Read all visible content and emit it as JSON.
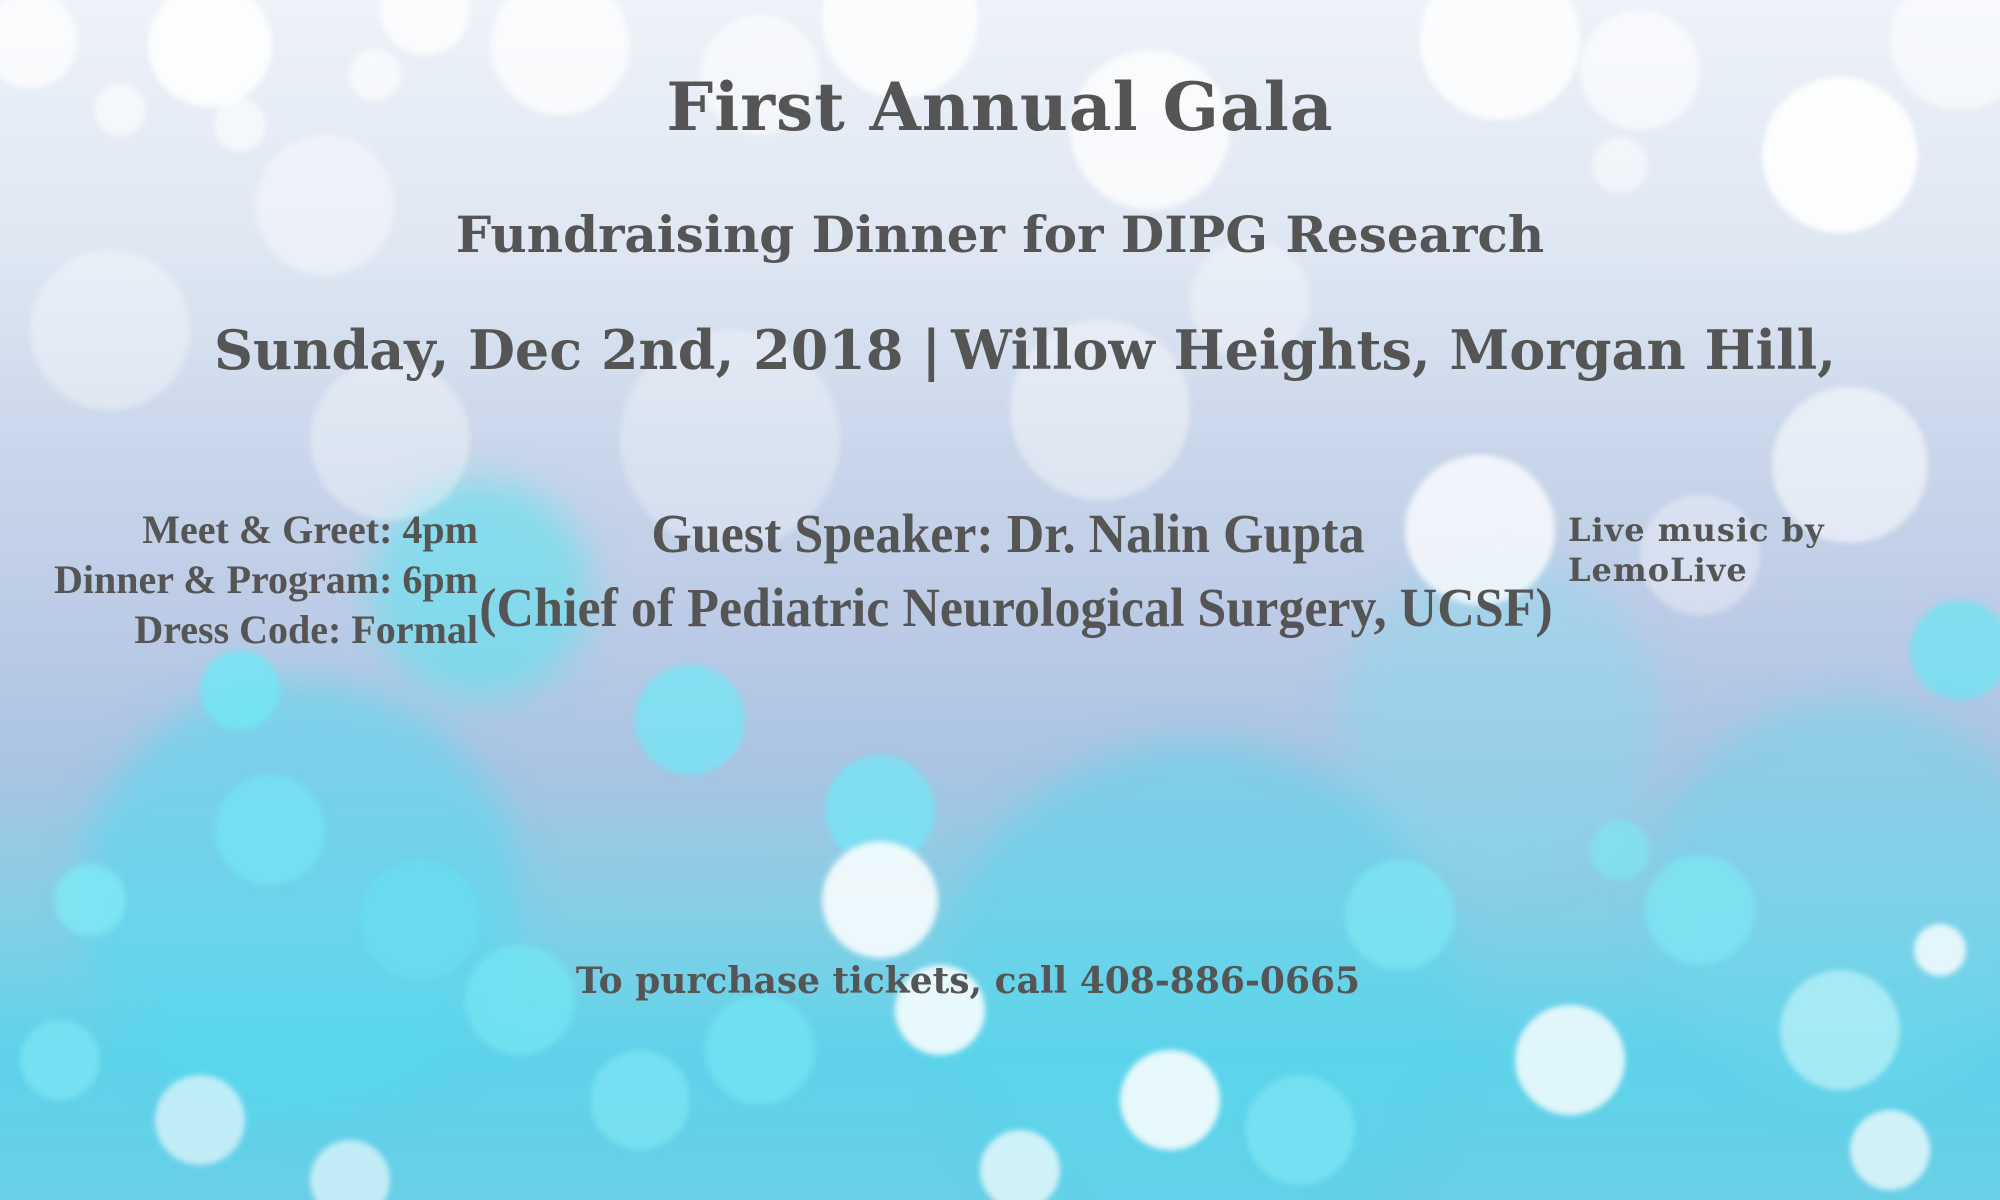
{
  "event": {
    "title": "First Annual Gala",
    "subtitle": "Fundraising Dinner for DIPG Research",
    "date": "Sunday, Dec 2nd, 2018",
    "separator": "|",
    "location": "Willow Heights, Morgan Hill,"
  },
  "schedule": {
    "items": [
      "Meet & Greet: 4pm",
      "Dinner & Program: 6pm",
      "Dress Code: Formal"
    ]
  },
  "speaker": {
    "line1": "Guest Speaker: Dr. Nalin Gupta",
    "line2": "(Chief of Pediatric Neurological Surgery, UCSF)"
  },
  "music": {
    "line1": "Live music by",
    "line2": "LemoLive"
  },
  "tickets": {
    "text": "To purchase tickets, call 408-886-0665"
  },
  "colors": {
    "text": "#555555",
    "background_top": "#eef2f8",
    "background_bottom": "#5dd3ea"
  }
}
